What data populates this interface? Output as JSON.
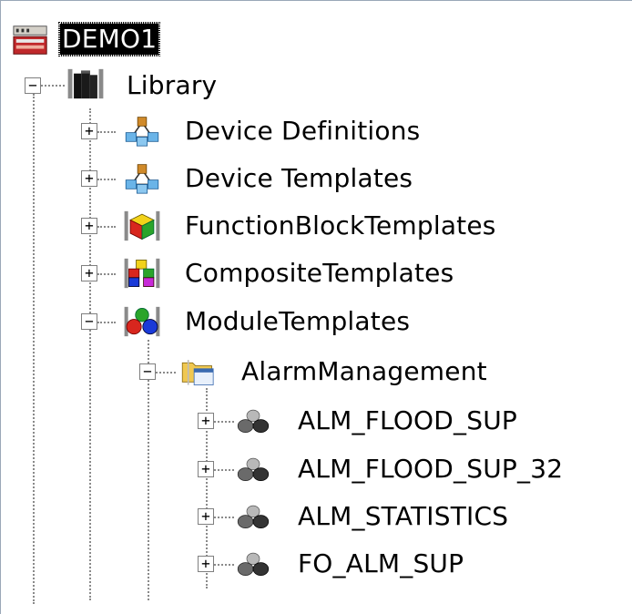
{
  "tree": {
    "root": {
      "label": "DEMO1",
      "icon": "database-server-icon"
    },
    "library": {
      "label": "Library",
      "icon": "library-books-icon",
      "expander": "−"
    },
    "children": [
      {
        "label": "Device Definitions",
        "icon": "device-network-icon",
        "expander": "+"
      },
      {
        "label": "Device Templates",
        "icon": "device-network-icon",
        "expander": "+"
      },
      {
        "label": "FunctionBlockTemplates",
        "icon": "function-block-cube-icon",
        "expander": "+"
      },
      {
        "label": "CompositeTemplates",
        "icon": "composite-cubes-icon",
        "expander": "+"
      },
      {
        "label": "ModuleTemplates",
        "icon": "module-cubes-icon",
        "expander": "−"
      }
    ],
    "alarm_folder": {
      "label": "AlarmManagement",
      "icon": "folder-window-icon",
      "expander": "−"
    },
    "alarm_items": [
      {
        "label": "ALM_FLOOD_SUP",
        "icon": "module-gray-cubes-icon",
        "expander": "+"
      },
      {
        "label": "ALM_FLOOD_SUP_32",
        "icon": "module-gray-cubes-icon",
        "expander": "+"
      },
      {
        "label": "ALM_STATISTICS",
        "icon": "module-gray-cubes-icon",
        "expander": "+"
      },
      {
        "label": "FO_ALM_SUP",
        "icon": "module-gray-cubes-icon",
        "expander": "+"
      }
    ]
  }
}
